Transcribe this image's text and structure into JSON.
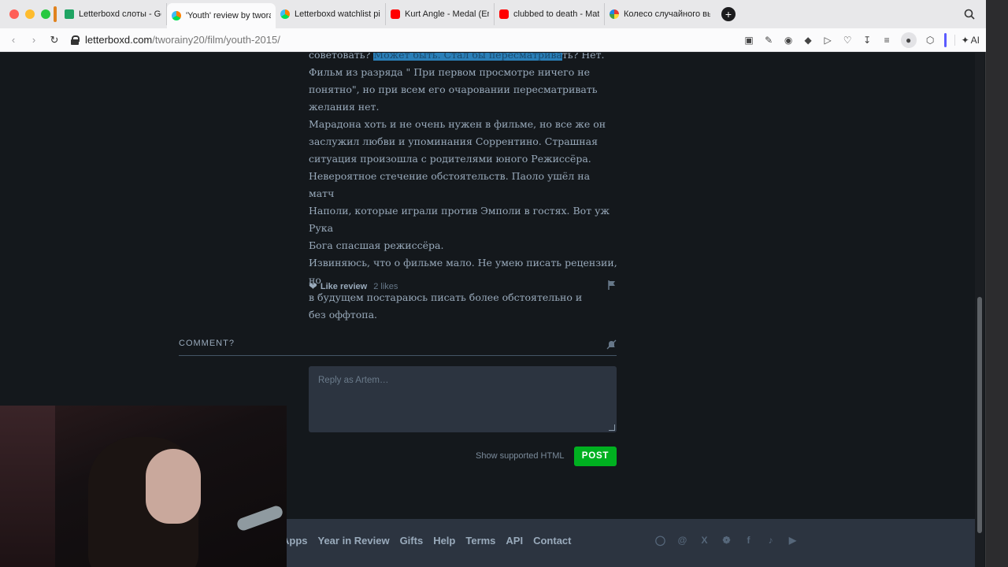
{
  "browser": {
    "tabs": [
      {
        "title": "Letterboxd слоты - Goo",
        "favicon": "sheets",
        "active": false
      },
      {
        "title": "'Youth' review by tworai",
        "favicon": "letterboxd",
        "active": true
      },
      {
        "title": "Letterboxd watchlist pic",
        "favicon": "letterboxd",
        "active": false
      },
      {
        "title": "Kurt Angle - Medal (Entr",
        "favicon": "youtube",
        "active": false
      },
      {
        "title": "clubbed to death - Matri",
        "favicon": "youtube",
        "active": false
      },
      {
        "title": "Колесо случайного выб",
        "favicon": "wheel",
        "active": false
      }
    ],
    "new_tab": "+",
    "url_domain": "letterboxd.com",
    "url_path": "/tworainy20/film/youth-2015/",
    "ai_label": "AI"
  },
  "review": {
    "lines": [
      {
        "pre": "советовать? ",
        "hl": "Может быть. Стал бы пересматрива",
        "post": "ть? Нет."
      },
      {
        "pre": "Фильм из разряда \" При первом просмотре ничего не",
        "hl": "",
        "post": ""
      },
      {
        "pre": "понятно\", но при всем его очаровании пересматривать",
        "hl": "",
        "post": ""
      },
      {
        "pre": "желания нет.",
        "hl": "",
        "post": ""
      },
      {
        "pre": "Марадона хоть и не очень нужен в фильме, но все же он",
        "hl": "",
        "post": ""
      },
      {
        "pre": "заслужил любви и упоминания Соррентино. Страшная",
        "hl": "",
        "post": ""
      },
      {
        "pre": "ситуация произошла с родителями юного Режиссёра.",
        "hl": "",
        "post": ""
      },
      {
        "pre": "Невероятное стечение обстоятельств. Паоло ушёл на матч",
        "hl": "",
        "post": ""
      },
      {
        "pre": "Наполи, которые играли против Эмполи в гостях. Вот уж Рука",
        "hl": "",
        "post": ""
      },
      {
        "pre": "Бога спасшая режиссёра.",
        "hl": "",
        "post": ""
      },
      {
        "pre": "Извиняюсь, что о фильме мало. Не умею писать рецензии, но",
        "hl": "",
        "post": ""
      },
      {
        "pre": "в будущем постараюсь писать более обстоятельно и",
        "hl": "",
        "post": ""
      },
      {
        "pre": "без оффтопа.",
        "hl": "",
        "post": ""
      }
    ],
    "like_label": "Like review",
    "likes_count": "2 likes"
  },
  "comment": {
    "heading": "COMMENT?",
    "placeholder": "Reply as Artem…",
    "html_link": "Show supported HTML",
    "post_label": "POST"
  },
  "footer": {
    "links": [
      "Apps",
      "Year in Review",
      "Gifts",
      "Help",
      "Terms",
      "API",
      "Contact"
    ],
    "social_icons": [
      "instagram-icon",
      "threads-icon",
      "x-icon",
      "bluesky-icon",
      "facebook-icon",
      "tiktok-icon",
      "youtube-icon"
    ]
  },
  "colors": {
    "page_bg": "#14181c",
    "text": "#99aabb",
    "post_button": "#00b020",
    "highlight": "#2a7fb8",
    "footer_bg": "#2c3440"
  }
}
